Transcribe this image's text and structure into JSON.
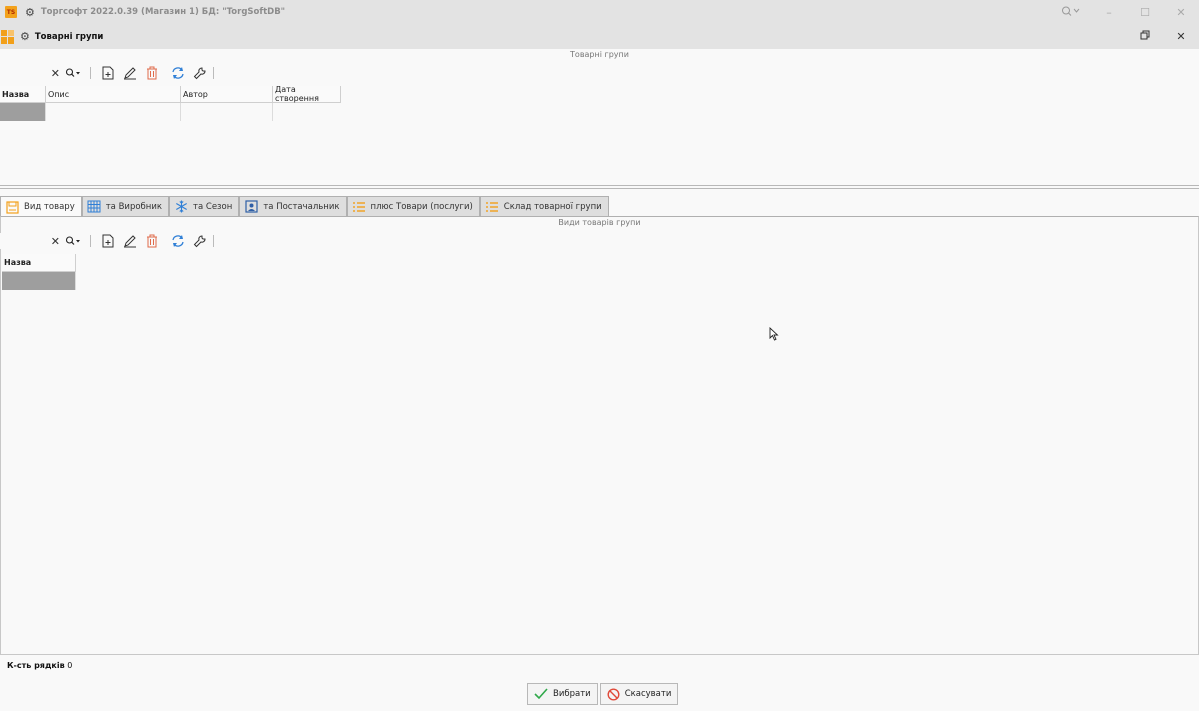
{
  "window": {
    "title": "Торгсофт 2022.0.39 (Магазин 1) БД: \"TorgSoftDB\"",
    "logo_text": "TS"
  },
  "form": {
    "title": "Товарні групи"
  },
  "top_section": {
    "caption": "Товарні групи",
    "columns": [
      "Назва",
      "Опис",
      "Автор",
      "Дата створення"
    ]
  },
  "tabs": [
    {
      "label": "Вид товару",
      "icon": "box-icon"
    },
    {
      "label": "та Виробник",
      "icon": "building-icon"
    },
    {
      "label": "та Сезон",
      "icon": "snowflake-icon"
    },
    {
      "label": "та Постачальник",
      "icon": "supplier-icon"
    },
    {
      "label": "плюс Товари (послуги)",
      "icon": "list-icon"
    },
    {
      "label": "Склад товарної групи",
      "icon": "list-icon"
    }
  ],
  "bottom_section": {
    "caption": "Види товарів групи",
    "columns": [
      "Назва"
    ]
  },
  "status": {
    "rowcount_label": "К-сть рядків",
    "rowcount_value": "0"
  },
  "buttons": {
    "select_label": "Вибрати",
    "cancel_label": "Скасувати"
  },
  "colors": {
    "accent_orange": "#f2a01a",
    "accent_blue": "#2f7fd6",
    "delete_red": "#e06a4a",
    "selection_gray": "#9e9e9e"
  }
}
